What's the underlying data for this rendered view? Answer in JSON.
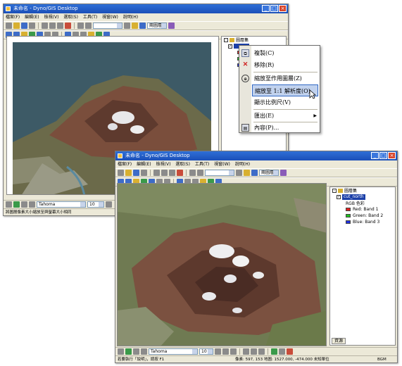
{
  "window_a": {
    "title": "未命名 - Dyno/GIS Desktop",
    "menu": [
      "檔案(F)",
      "編輯(E)",
      "檢視(V)",
      "選取(S)",
      "工具(T)",
      "視窗(W)",
      "說明(H)"
    ],
    "layer_combo": "兩圖層",
    "toc_root": "圖層集",
    "font_combo": "Tahoma",
    "font_size": "10",
    "status": "將圖層像素大小縮放至與螢幕大小相同"
  },
  "window_b": {
    "title": "未命名 - Dyno/GIS Desktop",
    "menu": [
      "檔案(F)",
      "編輯(E)",
      "檢視(V)",
      "選取(S)",
      "工具(T)",
      "視窗(W)",
      "說明(H)"
    ],
    "layer_combo": "兩圖層",
    "toc": {
      "root": "圖層集",
      "layer": "cut_north",
      "rgb_label": "RGB 色彩",
      "bands": [
        {
          "label": "Red:   Band 1",
          "color": "#e02020"
        },
        {
          "label": "Green: Band 2",
          "color": "#20c020"
        },
        {
          "label": "Blue:  Band 3",
          "color": "#2030e0"
        }
      ],
      "tab": "資源"
    },
    "font_combo": "Tahoma",
    "font_size": "10",
    "status_left": "若要執行「說明」，請按 F1",
    "status_right": "像素: 597, 153  地圖: 1527.000, -474.000 未知單位",
    "status_mode": "BGM"
  },
  "context_menu": {
    "items": [
      {
        "label": "複製(C)",
        "icon": "copy-icon"
      },
      {
        "label": "移除(R)",
        "icon": "remove-icon"
      },
      {
        "label": "縮放至作用圖層(Z)",
        "icon": "zoom-layer-icon"
      },
      {
        "label": "縮放至 1:1 解析度(O)",
        "icon": "zoom-one-to-one-icon"
      },
      {
        "label": "顯示比例尺(V)",
        "icon": ""
      },
      {
        "label": "匯出(E)",
        "icon": ""
      },
      {
        "label": "內容(P)...",
        "icon": "properties-icon"
      }
    ]
  }
}
